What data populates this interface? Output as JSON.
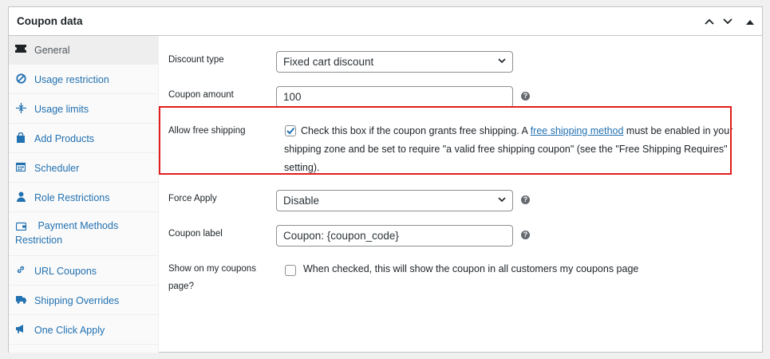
{
  "panel": {
    "title": "Coupon data"
  },
  "sidebar": {
    "items": [
      {
        "label": "General",
        "icon": "ticket-icon"
      },
      {
        "label": "Usage restriction",
        "icon": "block-icon"
      },
      {
        "label": "Usage limits",
        "icon": "arrows-icon"
      },
      {
        "label": "Add Products",
        "icon": "bag-icon"
      },
      {
        "label": "Scheduler",
        "icon": "calendar-icon"
      },
      {
        "label": "Role Restrictions",
        "icon": "user-icon"
      },
      {
        "label": "Payment Methods Restriction",
        "icon": "wallet-icon"
      },
      {
        "label": "URL Coupons",
        "icon": "link-icon"
      },
      {
        "label": "Shipping Overrides",
        "icon": "truck-icon"
      },
      {
        "label": "One Click Apply",
        "icon": "megaphone-icon"
      }
    ],
    "active_index": 0
  },
  "fields": {
    "discount_type": {
      "label": "Discount type",
      "value": "Fixed cart discount"
    },
    "coupon_amount": {
      "label": "Coupon amount",
      "value": "100"
    },
    "free_shipping": {
      "label": "Allow free shipping",
      "checked": true,
      "text_before": "Check this box if the coupon grants free shipping. A ",
      "link": "free shipping method",
      "text_after": " must be enabled in your",
      "line2": "shipping zone and be set to require \"a valid free shipping coupon\" (see the \"Free Shipping Requires\"",
      "line3": "setting)."
    },
    "force_apply": {
      "label": "Force Apply",
      "value": "Disable"
    },
    "coupon_label": {
      "label": "Coupon label",
      "value": "Coupon: {coupon_code}"
    },
    "show_on_my_coupons": {
      "label_line1": "Show on my coupons",
      "label_line2": "page?",
      "checked": false,
      "text": "When checked, this will show the coupon in all customers my coupons page"
    }
  },
  "help_glyph": "?",
  "colors": {
    "link": "#2271b1",
    "accent_check": "#2271b1",
    "highlight": "#e11d1d"
  }
}
